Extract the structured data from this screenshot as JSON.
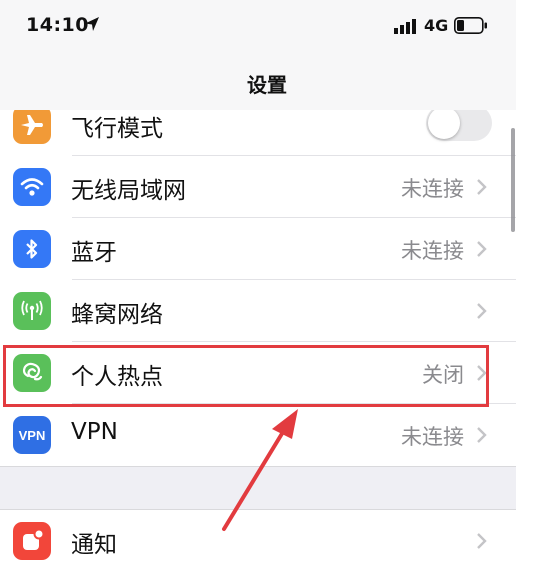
{
  "status_bar": {
    "time": "14:10",
    "network": "4G",
    "icons": [
      "location-arrow-icon",
      "signal-bars-icon",
      "battery-icon"
    ]
  },
  "nav": {
    "title": "设置"
  },
  "settings": [
    {
      "label": "飞行模式",
      "icon": "airplane-icon",
      "icon_color": "#f19a37",
      "control": "toggle",
      "toggle_on": false
    },
    {
      "label": "无线局域网",
      "icon": "wifi-icon",
      "icon_color": "#3478f6",
      "value": "未连接"
    },
    {
      "label": "蓝牙",
      "icon": "bluetooth-icon",
      "icon_color": "#3478f6",
      "value": "未连接"
    },
    {
      "label": "蜂窝网络",
      "icon": "cellular-antenna-icon",
      "icon_color": "#5ac05a",
      "value": ""
    },
    {
      "label": "个人热点",
      "icon": "personal-hotspot-icon",
      "icon_color": "#5ac05a",
      "value": "关闭"
    },
    {
      "label": "VPN",
      "icon": "vpn-icon",
      "icon_color": "#2f6fe4",
      "icon_text": "VPN",
      "value": "未连接"
    }
  ],
  "settings2": [
    {
      "label": "通知",
      "icon": "notifications-icon",
      "icon_color": "#f2463a"
    }
  ],
  "annotation": {
    "highlight_color": "#e23b3f",
    "highlighted_item": "个人热点"
  }
}
